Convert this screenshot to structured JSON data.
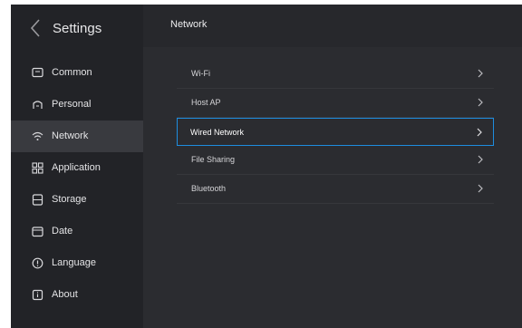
{
  "sidebar": {
    "title": "Settings",
    "items": [
      {
        "label": "Common",
        "icon": "monitor-icon"
      },
      {
        "label": "Personal",
        "icon": "person-icon"
      },
      {
        "label": "Network",
        "icon": "wifi-icon"
      },
      {
        "label": "Application",
        "icon": "apps-grid-icon"
      },
      {
        "label": "Storage",
        "icon": "storage-icon"
      },
      {
        "label": "Date",
        "icon": "calendar-icon"
      },
      {
        "label": "Language",
        "icon": "globe-icon"
      },
      {
        "label": "About",
        "icon": "info-icon"
      }
    ],
    "active": "Network"
  },
  "main": {
    "title": "Network",
    "rows": [
      {
        "label": "Wi-Fi"
      },
      {
        "label": "Host AP"
      },
      {
        "label": "Wired Network"
      },
      {
        "label": "File Sharing"
      },
      {
        "label": "Bluetooth"
      }
    ],
    "selected": "Wired Network"
  },
  "colors": {
    "focus_border": "#1e8ddf",
    "sidebar_bg": "#222327",
    "main_bg": "#2b2c30"
  }
}
